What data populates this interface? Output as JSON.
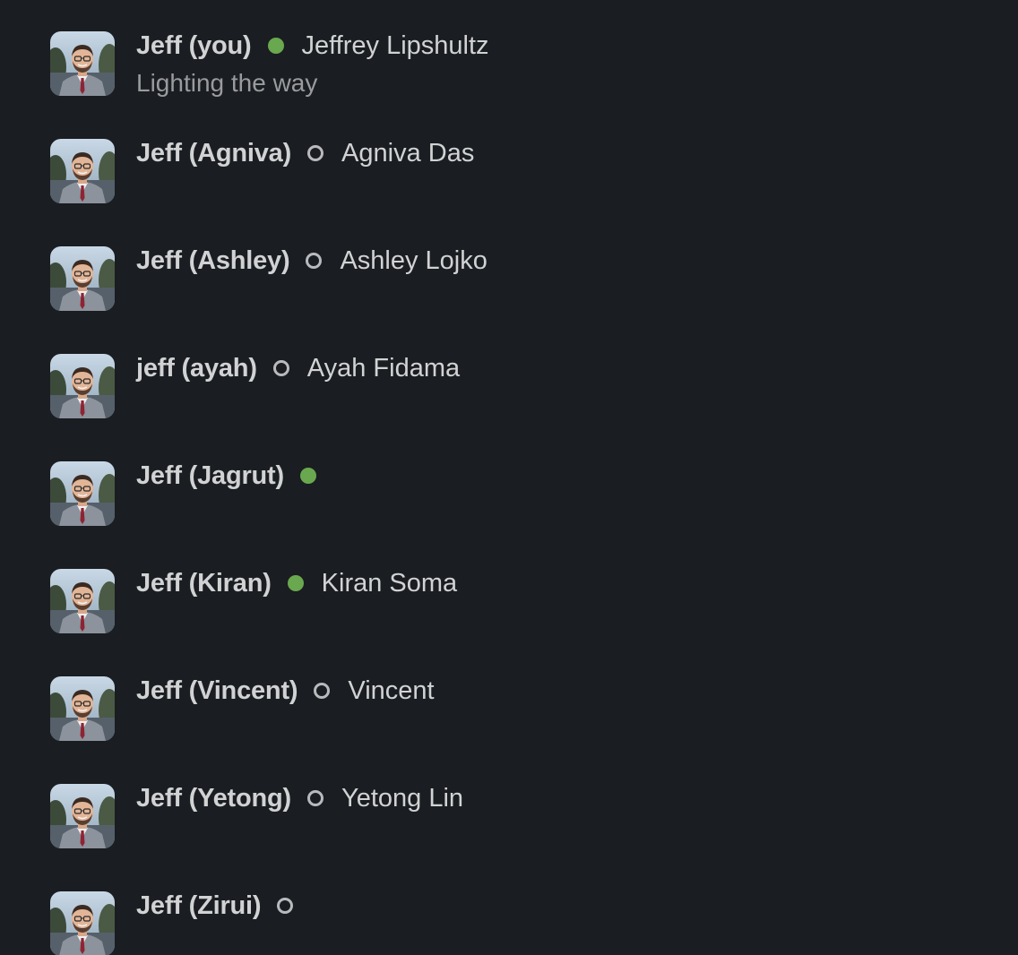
{
  "members": [
    {
      "display_name": "Jeff (you)",
      "presence": "active",
      "full_name": "Jeffrey Lipshultz",
      "status": "Lighting the way",
      "avatar_icon": "profile-photo"
    },
    {
      "display_name": "Jeff (Agniva)",
      "presence": "away",
      "full_name": "Agniva Das",
      "status": "",
      "avatar_icon": "profile-photo"
    },
    {
      "display_name": "Jeff (Ashley)",
      "presence": "away",
      "full_name": "Ashley Lojko",
      "status": "",
      "avatar_icon": "profile-photo"
    },
    {
      "display_name": "jeff (ayah)",
      "presence": "away",
      "full_name": "Ayah Fidama",
      "status": "",
      "avatar_icon": "profile-photo"
    },
    {
      "display_name": "Jeff (Jagrut)",
      "presence": "active",
      "full_name": "",
      "status": "",
      "avatar_icon": "profile-photo"
    },
    {
      "display_name": "Jeff (Kiran)",
      "presence": "active",
      "full_name": "Kiran Soma",
      "status": "",
      "avatar_icon": "profile-photo"
    },
    {
      "display_name": "Jeff (Vincent)",
      "presence": "away",
      "full_name": "Vincent",
      "status": "",
      "avatar_icon": "profile-photo"
    },
    {
      "display_name": "Jeff (Yetong)",
      "presence": "away",
      "full_name": "Yetong Lin",
      "status": "",
      "avatar_icon": "profile-photo"
    },
    {
      "display_name": "Jeff (Zirui)",
      "presence": "away",
      "full_name": "",
      "status": "",
      "avatar_icon": "profile-photo"
    }
  ],
  "colors": {
    "background": "#1a1d21",
    "text_primary": "#d1d2d3",
    "text_secondary": "#9a9b9e",
    "presence_active": "#6aa84f",
    "presence_away": "#b9babd"
  }
}
